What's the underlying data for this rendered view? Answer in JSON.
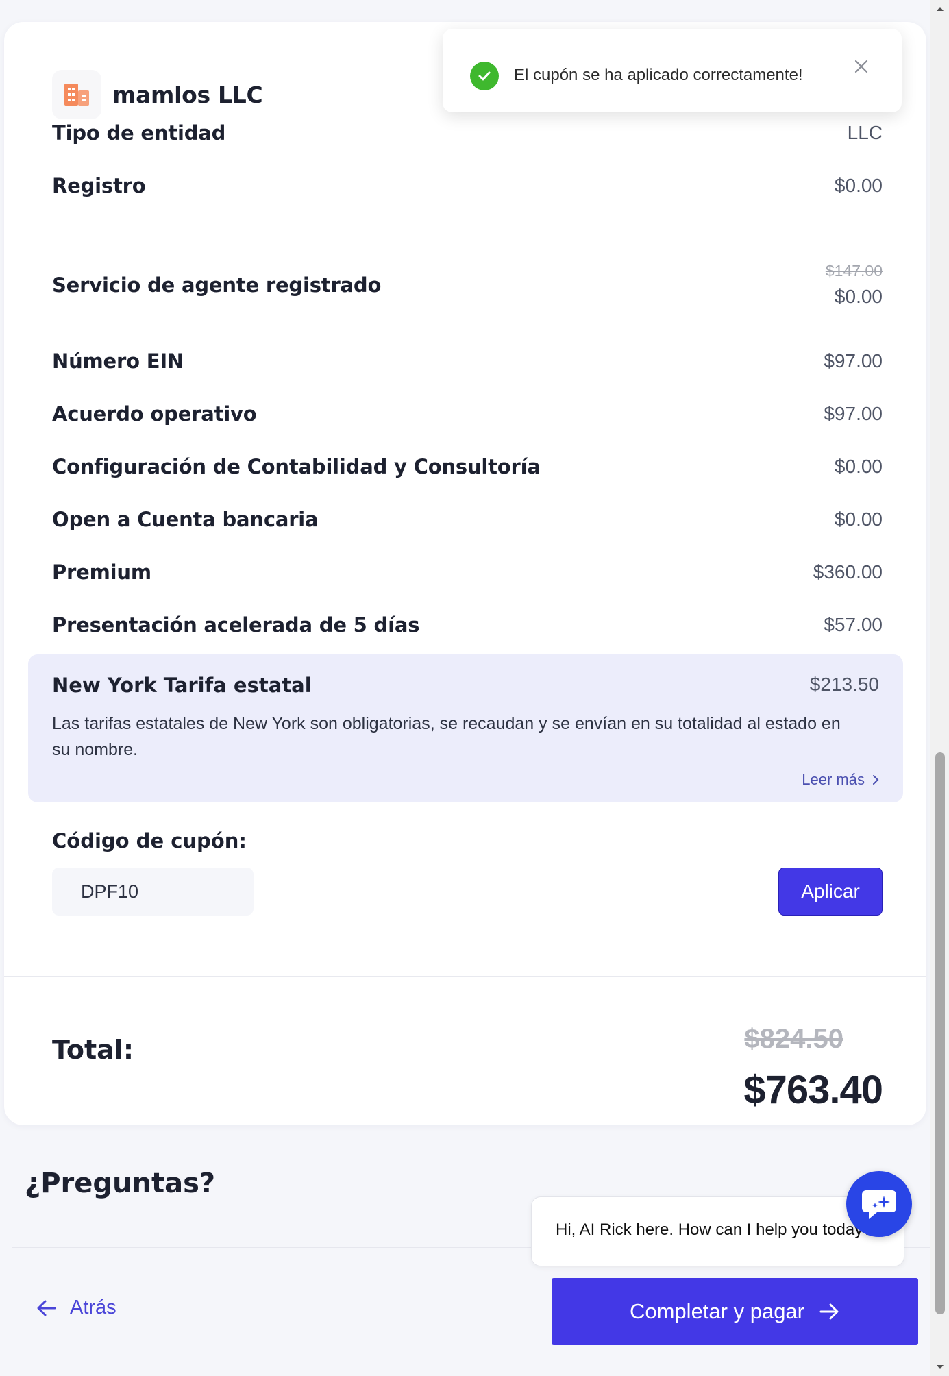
{
  "company": {
    "name": "mamlos LLC",
    "logo_icon": "building-icon"
  },
  "toast": {
    "message": "El cupón se ha aplicado correctamente!",
    "icon": "check-circle-icon",
    "close_icon": "close-icon"
  },
  "summary": {
    "entity_type": {
      "label": "Tipo de entidad",
      "value": "LLC"
    },
    "registration": {
      "label": "Registro",
      "value": "$0.00"
    },
    "registered_agent": {
      "label": "Servicio de agente registrado",
      "old_value": "$147.00",
      "value": "$0.00"
    },
    "ein": {
      "label": "Número EIN",
      "value": "$97.00"
    },
    "operating_agreement": {
      "label": "Acuerdo operativo",
      "value": "$97.00"
    },
    "accounting": {
      "label": "Configuración de Contabilidad y Consultoría",
      "value": "$0.00"
    },
    "bank_account": {
      "label": "Open a Cuenta bancaria",
      "value": "$0.00"
    },
    "premium": {
      "label": "Premium",
      "value": "$360.00"
    },
    "expedited": {
      "label": "Presentación acelerada de 5 días",
      "value": "$57.00"
    }
  },
  "state_fee": {
    "title": "New York Tarifa estatal",
    "amount": "$213.50",
    "description": "Las tarifas estatales de New York son obligatorias, se recaudan y se envían en su totalidad al estado en su nombre.",
    "read_more": "Leer más"
  },
  "coupon": {
    "label": "Código de cupón:",
    "value": "DPF10",
    "apply_label": "Aplicar"
  },
  "total": {
    "label": "Total:",
    "old_value": "$824.50",
    "value": "$763.40"
  },
  "questions": {
    "title": "¿Preguntas?"
  },
  "chat": {
    "message": "Hi, AI Rick here. How can I help you today?",
    "launcher_icon": "chat-sparkle-icon"
  },
  "nav": {
    "back_label": "Atrás",
    "pay_label": "Completar y pagar"
  },
  "colors": {
    "accent": "#4338e6",
    "success": "#3fb82e",
    "logo": "#f58a5c",
    "state_fee_bg": "#ecedfb"
  }
}
